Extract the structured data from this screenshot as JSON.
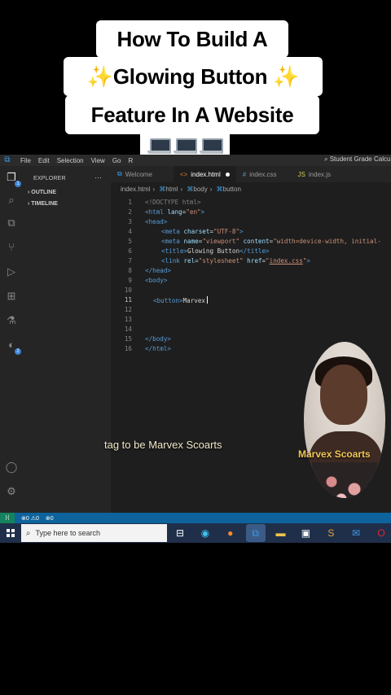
{
  "banner": {
    "line1": "How To Build A",
    "line2": "✨Glowing Button ✨",
    "line3": "Feature In A Website",
    "laptops": "💻💻💻"
  },
  "menubar": {
    "items": [
      "File",
      "Edit",
      "Selection",
      "View",
      "Go",
      "R"
    ],
    "search": "Student Grade Calcu"
  },
  "sidebar": {
    "title": "EXPLORER",
    "more": "···",
    "sections": [
      "OUTLINE",
      "TIMELINE"
    ]
  },
  "tabs": [
    {
      "label": "Welcome",
      "icon": "vscode-icon"
    },
    {
      "label": "index.html",
      "icon": "html-icon",
      "modified": true
    },
    {
      "label": "index.css",
      "icon": "css-icon"
    },
    {
      "label": "index.js",
      "icon": "js-icon"
    }
  ],
  "breadcrumbs": [
    "index.html",
    "html",
    "body",
    "button"
  ],
  "code_lines": [
    {
      "n": "1"
    },
    {
      "n": "2"
    },
    {
      "n": "3"
    },
    {
      "n": "4"
    },
    {
      "n": "5"
    },
    {
      "n": "6"
    },
    {
      "n": "7"
    },
    {
      "n": "8"
    },
    {
      "n": "9"
    },
    {
      "n": "10"
    },
    {
      "n": "11"
    },
    {
      "n": "12"
    },
    {
      "n": "13"
    },
    {
      "n": "14"
    },
    {
      "n": "15"
    },
    {
      "n": "16"
    }
  ],
  "code": {
    "l1": "<!DOCTYPE html>",
    "l2a": "<html ",
    "l2b": "lang",
    "l2c": "=",
    "l2d": "\"en\"",
    "l2e": ">",
    "l3": "<head>",
    "l4a": "<meta ",
    "l4b": "charset",
    "l4c": "=",
    "l4d": "\"UTF-8\"",
    "l4e": ">",
    "l5a": "<meta ",
    "l5b": "name",
    "l5c": "=",
    "l5d": "\"viewport\"",
    "l5e": " content",
    "l5f": "=",
    "l5g": "\"width=device-width, initial-",
    "l6a": "<title>",
    "l6b": "Glowing Button",
    "l6c": "</title>",
    "l7a": "<link ",
    "l7b": "rel",
    "l7c": "=",
    "l7d": "\"stylesheet\"",
    "l7e": " href",
    "l7f": "=",
    "l7g": "\"",
    "l7h": "index.css",
    "l7i": "\"",
    "l7j": ">",
    "l8": "</head>",
    "l9": "<body>",
    "l11a": "<button>",
    "l11b": "Marvex",
    "l15": "</body>",
    "l16": "</html>"
  },
  "statusbar": {
    "problems": "⊗0 ⚠0",
    "ports": "⊕0"
  },
  "taskbar": {
    "search_placeholder": "Type here to search"
  },
  "caption": "tag to be Marvex Scoarts",
  "presenter_name": "Marvex Scoarts",
  "colors": {
    "accent": "#0e639c",
    "caption": "#f2e8c9",
    "name_tag": "#f0c659"
  }
}
